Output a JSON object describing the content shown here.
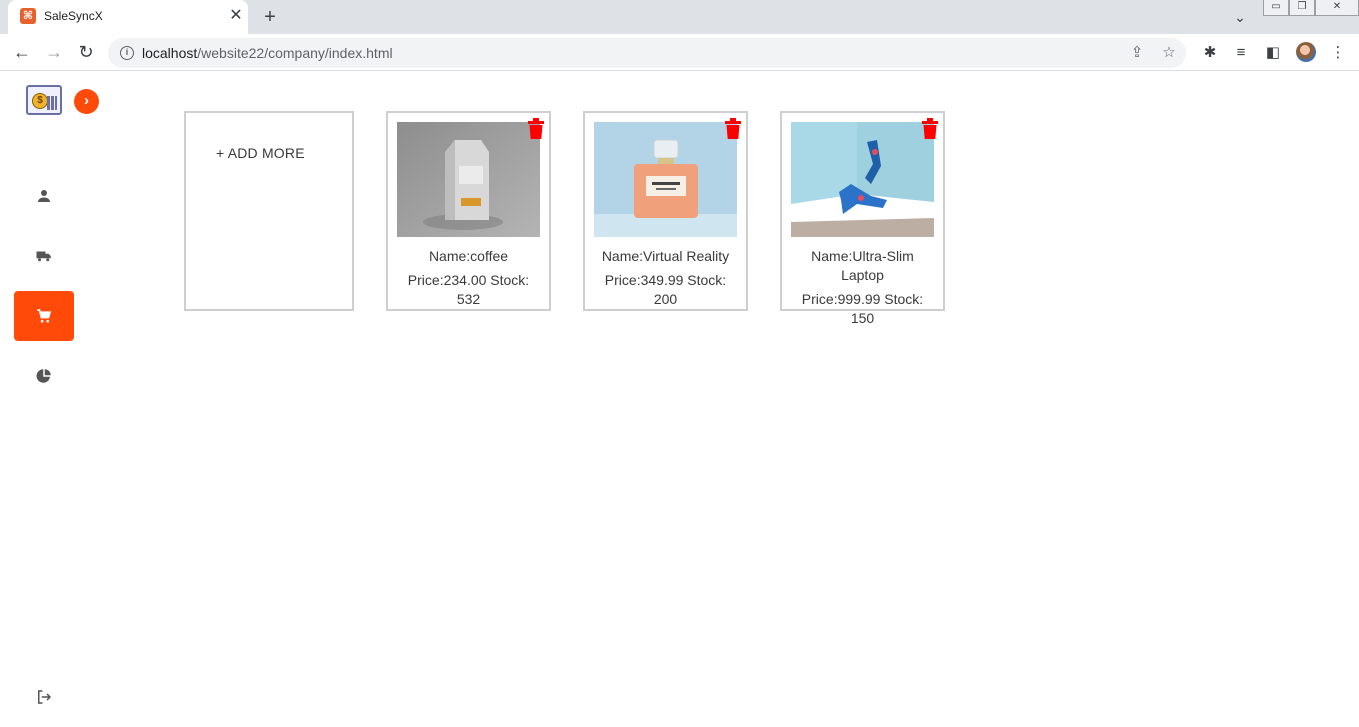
{
  "browser": {
    "tab_title": "SaleSyncX",
    "url_host": "localhost",
    "url_path": "/website22/company/index.html"
  },
  "sidebar": {
    "items": [
      {
        "icon": "user-icon",
        "active": false
      },
      {
        "icon": "truck-icon",
        "active": false
      },
      {
        "icon": "cart-icon",
        "active": true
      },
      {
        "icon": "pie-chart-icon",
        "active": false
      }
    ],
    "accent_color": "#ff4a0a"
  },
  "add_card": {
    "label": "+ ADD MORE"
  },
  "products": [
    {
      "name_line": "Name:coffee",
      "meta_line1": "Price:234.00 Stock:",
      "meta_line2": "532",
      "image": "coffee-bag"
    },
    {
      "name_line": "Name:Virtual Reality",
      "meta_line1": "Price:349.99 Stock:",
      "meta_line2": "200",
      "image": "perfume-bottle"
    },
    {
      "name_line1": "Name:Ultra-Slim",
      "name_line2": "Laptop",
      "meta_line1": "Price:999.99 Stock:",
      "meta_line2": "150",
      "image": "high-heels"
    }
  ],
  "colors": {
    "delete": "#ff0000",
    "card_border": "#cfcfcf"
  }
}
